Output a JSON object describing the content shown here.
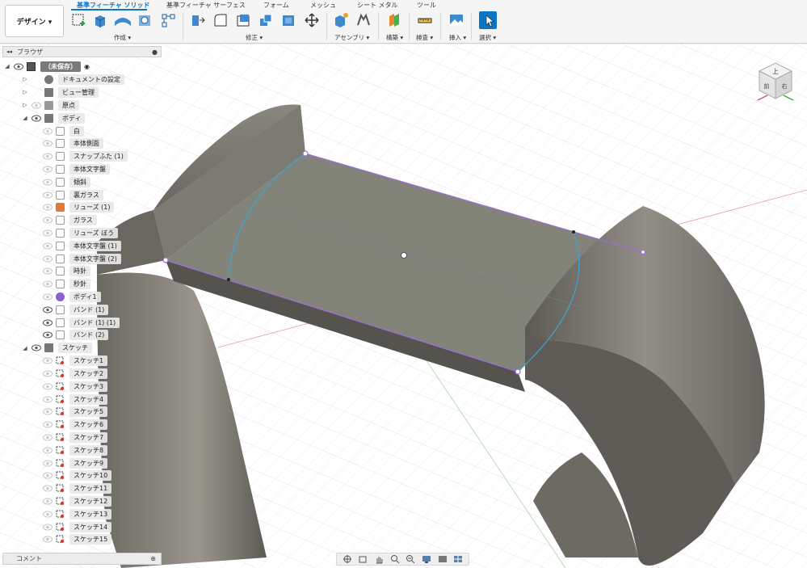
{
  "toolbar": {
    "workspace_button": "デザイン ▾",
    "tabs": [
      "基準フィーチャ ソリッド",
      "基準フィーチャ サーフェス",
      "フォーム",
      "メッシュ",
      "シート メタル",
      "ツール"
    ],
    "groups": {
      "create": "作成 ▾",
      "modify": "修正 ▾",
      "assemble": "アセンブリ ▾",
      "construct": "構築 ▾",
      "inspect": "検査 ▾",
      "insert": "挿入 ▾",
      "select": "選択 ▾"
    }
  },
  "browser": {
    "title": "ブラウザ",
    "root": "（未保存）",
    "items": [
      {
        "label": "ドキュメントの設定",
        "kind": "settings"
      },
      {
        "label": "ビュー管理",
        "kind": "folder"
      },
      {
        "label": "原点",
        "kind": "folder"
      },
      {
        "label": "ボディ",
        "kind": "folder"
      }
    ],
    "bodies": [
      {
        "label": "白",
        "visible": false
      },
      {
        "label": "本体側面",
        "visible": false
      },
      {
        "label": "スナップふた (1)",
        "visible": false
      },
      {
        "label": "本体文字盤",
        "visible": false
      },
      {
        "label": "傾斜",
        "visible": false
      },
      {
        "label": "裏ガラス",
        "visible": false
      },
      {
        "label": "リューズ (1)",
        "visible": false,
        "icon": "component"
      },
      {
        "label": "ガラス",
        "visible": false
      },
      {
        "label": "リューズ ぼう",
        "visible": false
      },
      {
        "label": "本体文字盤 (1)",
        "visible": false
      },
      {
        "label": "本体文字盤 (2)",
        "visible": false
      },
      {
        "label": "時針",
        "visible": false
      },
      {
        "label": "秒針",
        "visible": false
      },
      {
        "label": "ボディ1",
        "visible": false,
        "icon": "body-purple"
      },
      {
        "label": "バンド (1)",
        "visible": true
      },
      {
        "label": "バンド (1) (1)",
        "visible": true
      },
      {
        "label": "バンド (2)",
        "visible": true
      }
    ],
    "sketch_folder": "スケッチ",
    "sketches": [
      "スケッチ1",
      "スケッチ2",
      "スケッチ3",
      "スケッチ4",
      "スケッチ5",
      "スケッチ6",
      "スケッチ7",
      "スケッチ8",
      "スケッチ9",
      "スケッチ10",
      "スケッチ11",
      "スケッチ12",
      "スケッチ13",
      "スケッチ14",
      "スケッチ15"
    ]
  },
  "comments": {
    "label": "コメント"
  },
  "viewcube": {
    "faces": [
      "上",
      "前",
      "右"
    ]
  },
  "colors": {
    "accent": "#0a76c8",
    "sketch_line": "#9b6fd6",
    "arc": "#3aa6d8"
  }
}
